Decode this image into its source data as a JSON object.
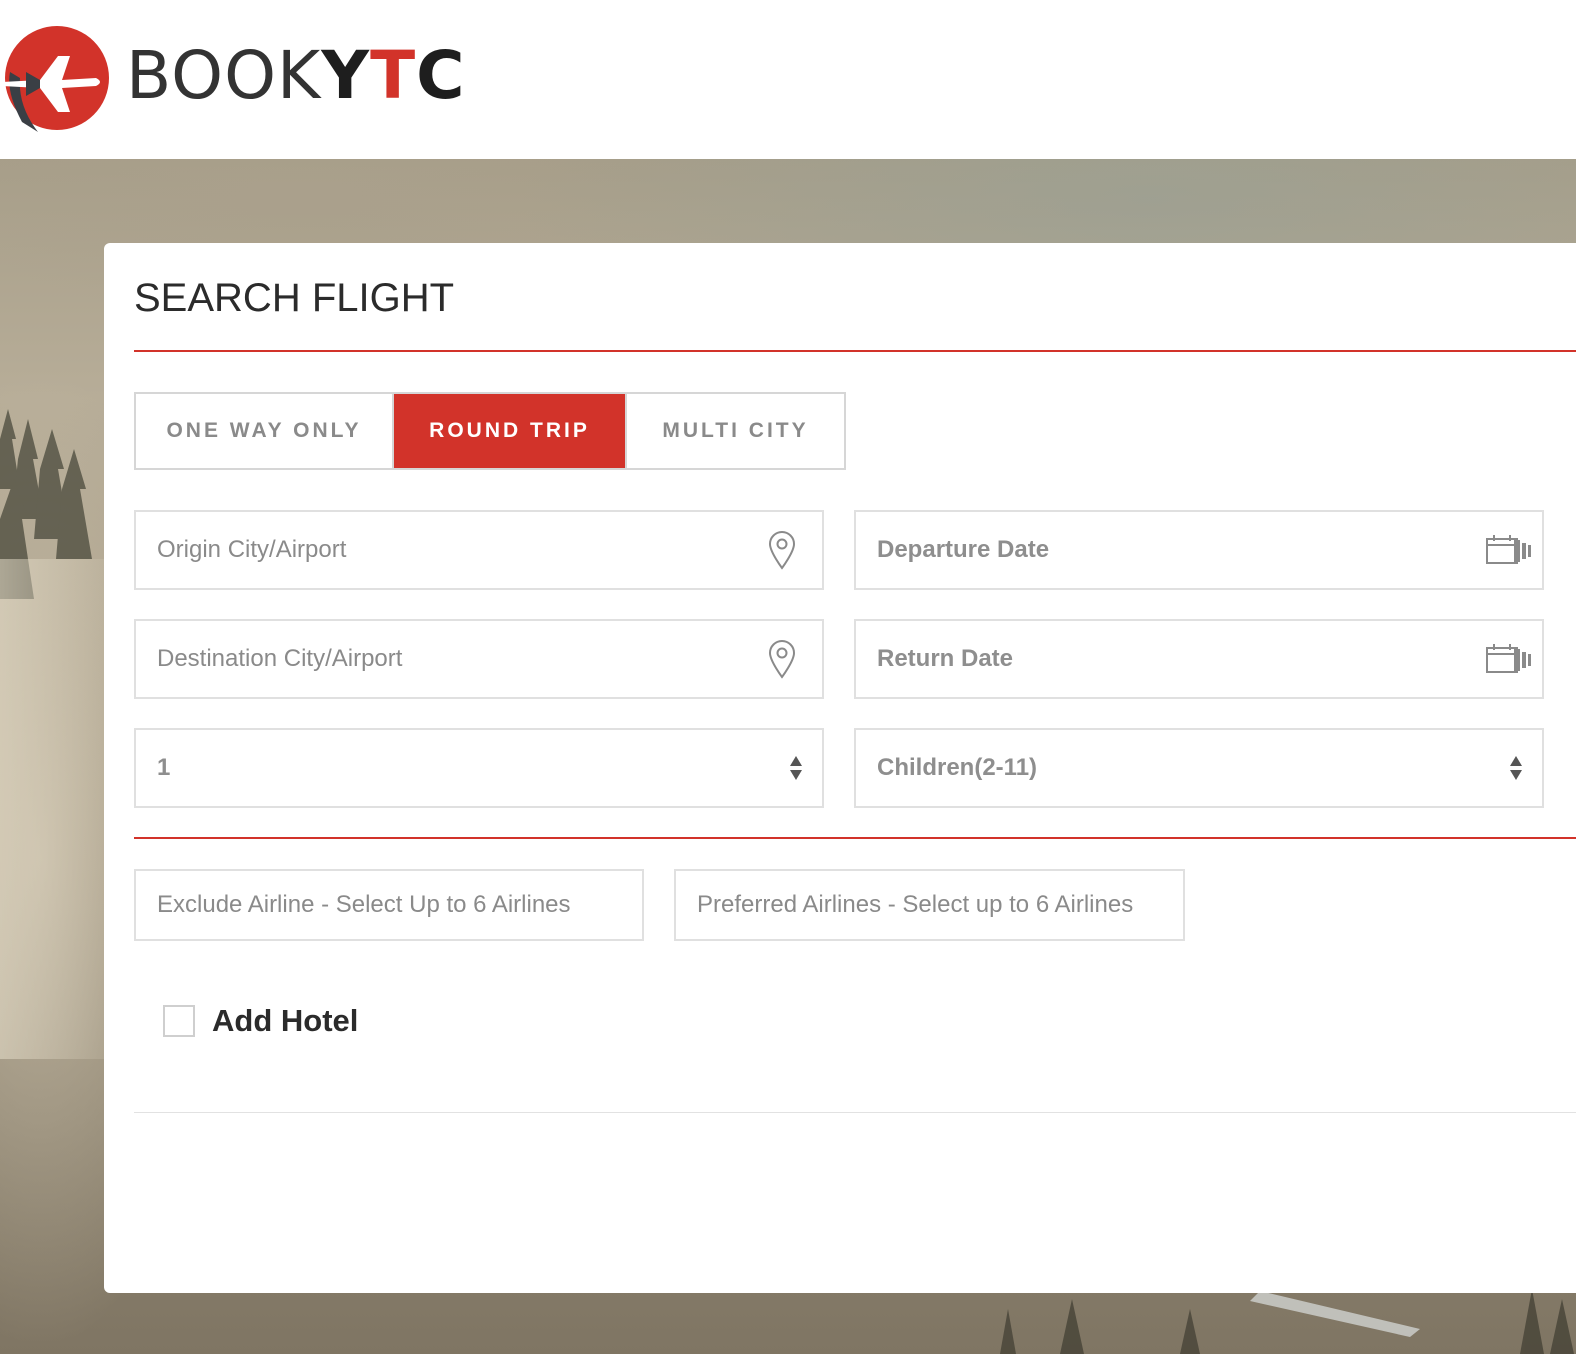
{
  "brand": {
    "logo_light": "BOOK",
    "logo_bold_y": "Y",
    "logo_red_t": "T",
    "logo_bold_c": "C",
    "accent_color": "#d2332a",
    "logo_icon": "airplane-logo-icon"
  },
  "search": {
    "title": "SEARCH FLIGHT",
    "trip_types": [
      {
        "label": "ONE WAY ONLY",
        "selected": false
      },
      {
        "label": "ROUND TRIP",
        "selected": true
      },
      {
        "label": "MULTI CITY",
        "selected": false
      }
    ],
    "origin": {
      "placeholder": "Origin City/Airport",
      "icon": "map-pin-icon"
    },
    "destination": {
      "placeholder": "Destination City/Airport",
      "icon": "map-pin-icon"
    },
    "departure_date": {
      "placeholder": "Departure Date",
      "icon": "calendar-icon"
    },
    "return_date": {
      "placeholder": "Return Date",
      "icon": "calendar-icon"
    },
    "adults": {
      "value": "1",
      "icon": "select-arrows-icon"
    },
    "children": {
      "value": "Children(2-11)",
      "icon": "select-arrows-icon"
    },
    "exclude_airline": {
      "placeholder": "Exclude Airline - Select Up to 6 Airlines"
    },
    "preferred_airlines": {
      "placeholder": "Preferred Airlines - Select up to 6 Airlines"
    },
    "add_hotel": {
      "label": "Add Hotel",
      "checked": false
    }
  }
}
